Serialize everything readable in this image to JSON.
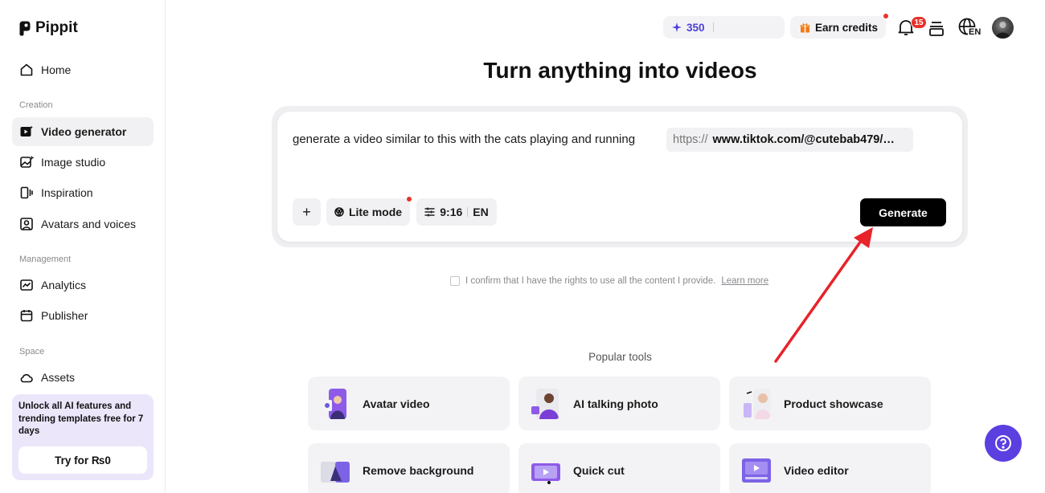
{
  "app": {
    "name": "Pippit"
  },
  "sidebar": {
    "home": "Home",
    "sections": {
      "creation": "Creation",
      "management": "Management",
      "space": "Space"
    },
    "creation_items": [
      "Video generator",
      "Image studio",
      "Inspiration",
      "Avatars and voices"
    ],
    "management_items": [
      "Analytics",
      "Publisher"
    ],
    "space_items": [
      "Assets"
    ],
    "active_item": "Video generator",
    "promo": {
      "text": "Unlock all AI features and trending templates free for 7 days",
      "button": "Try for ₨0"
    }
  },
  "topbar": {
    "credits": "350",
    "earn_credits": "Earn credits",
    "notification_count": "15",
    "language": "EN"
  },
  "main": {
    "title": "Turn anything into videos",
    "prompt": {
      "text": "generate a video similar to this with the cats playing and running",
      "url_protocol": "https://",
      "url_rest": "www.tiktok.com/@cutebab479/…"
    },
    "controls": {
      "add": "+",
      "mode": "Lite mode",
      "ratio": "9:16",
      "language": "EN",
      "generate": "Generate"
    },
    "confirm": {
      "text": "I confirm that I have the rights to use all the content I provide.",
      "link": "Learn more"
    },
    "popular_tools_label": "Popular tools",
    "tools": [
      "Avatar video",
      "AI talking photo",
      "Product showcase",
      "Remove background",
      "Quick cut",
      "Video editor"
    ]
  },
  "colors": {
    "accent": "#5b3fe0",
    "credits_text": "#4b3fd8",
    "alert_red": "#e6332a",
    "annotation_arrow": "#e8232a",
    "promo_bg": "#ece6fb"
  }
}
